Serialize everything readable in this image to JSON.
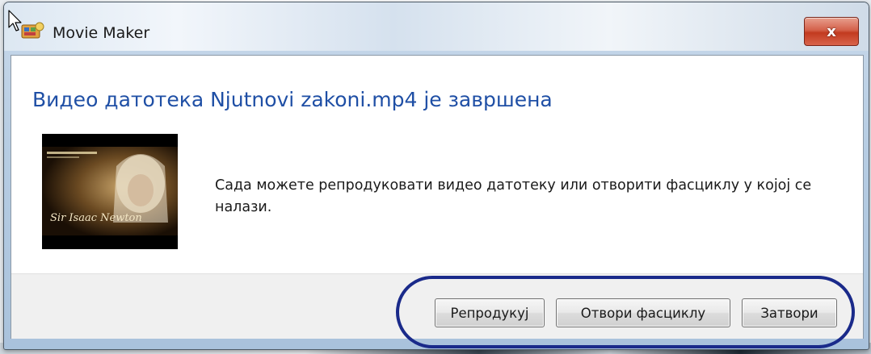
{
  "window": {
    "title": "Movie Maker",
    "close_glyph": "x"
  },
  "dialog": {
    "heading": "Видео датотека Njutnovi zakoni.mp4 је завршена",
    "message": "Сада можете репродуковати видео датотеку или отворити фасциклу у којој се налази.",
    "thumbnail": {
      "caption": "Sir Isaac Newton"
    }
  },
  "buttons": {
    "play": "Репродукуј",
    "open_folder": "Отвори фасциклу",
    "close": "Затвори"
  },
  "icons": {
    "app_icon": "movie-maker-icon",
    "close_icon": "close-icon",
    "cursor": "mouse-pointer-icon"
  },
  "colors": {
    "heading": "#1f4fa5",
    "close_button": "#c23a1f",
    "highlight_ellipse": "#1a2a8a"
  }
}
